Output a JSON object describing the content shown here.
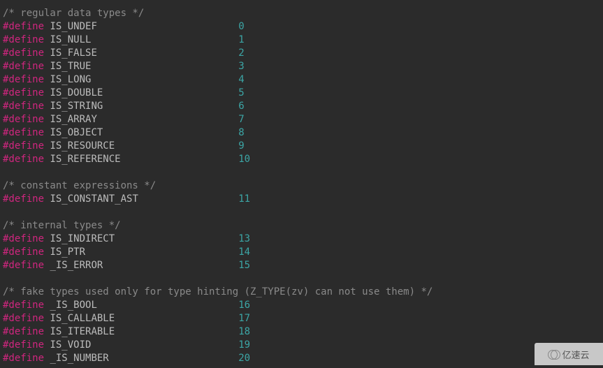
{
  "sections": [
    {
      "comment": "/* regular data types */",
      "defines": [
        {
          "name": "IS_UNDEF",
          "value": "0"
        },
        {
          "name": "IS_NULL",
          "value": "1"
        },
        {
          "name": "IS_FALSE",
          "value": "2"
        },
        {
          "name": "IS_TRUE",
          "value": "3"
        },
        {
          "name": "IS_LONG",
          "value": "4"
        },
        {
          "name": "IS_DOUBLE",
          "value": "5"
        },
        {
          "name": "IS_STRING",
          "value": "6"
        },
        {
          "name": "IS_ARRAY",
          "value": "7"
        },
        {
          "name": "IS_OBJECT",
          "value": "8"
        },
        {
          "name": "IS_RESOURCE",
          "value": "9"
        },
        {
          "name": "IS_REFERENCE",
          "value": "10"
        }
      ]
    },
    {
      "comment": "/* constant expressions */",
      "defines": [
        {
          "name": "IS_CONSTANT_AST",
          "value": "11"
        }
      ]
    },
    {
      "comment": "/* internal types */",
      "defines": [
        {
          "name": "IS_INDIRECT",
          "value": "13"
        },
        {
          "name": "IS_PTR",
          "value": "14"
        },
        {
          "name": "_IS_ERROR",
          "value": "15"
        }
      ]
    },
    {
      "comment": "/* fake types used only for type hinting (Z_TYPE(zv) can not use them) */",
      "defines": [
        {
          "name": "_IS_BOOL",
          "value": "16"
        },
        {
          "name": "IS_CALLABLE",
          "value": "17"
        },
        {
          "name": "IS_ITERABLE",
          "value": "18"
        },
        {
          "name": "IS_VOID",
          "value": "19"
        },
        {
          "name": "_IS_NUMBER",
          "value": "20"
        }
      ]
    }
  ],
  "directive": "#define",
  "watermark": "亿速云"
}
